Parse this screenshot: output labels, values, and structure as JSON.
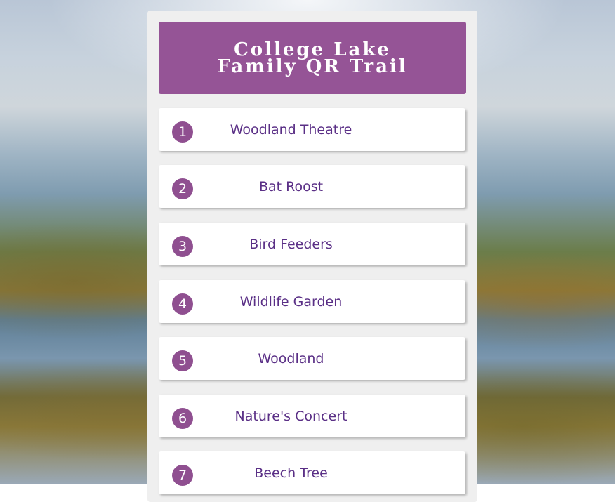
{
  "header": {
    "title_line1": "College Lake",
    "title_line2": "Family QR Trail"
  },
  "items": [
    {
      "number": "1",
      "label": "Woodland Theatre"
    },
    {
      "number": "2",
      "label": "Bat Roost"
    },
    {
      "number": "3",
      "label": "Bird Feeders"
    },
    {
      "number": "4",
      "label": "Wildlife Garden"
    },
    {
      "number": "5",
      "label": "Woodland"
    },
    {
      "number": "6",
      "label": "Nature's Concert"
    },
    {
      "number": "7",
      "label": "Beech Tree"
    }
  ],
  "colors": {
    "header_bg": "#955496",
    "badge_bg": "#8f4f90",
    "label_text": "#5a2f86",
    "panel_bg": "#efefef"
  }
}
